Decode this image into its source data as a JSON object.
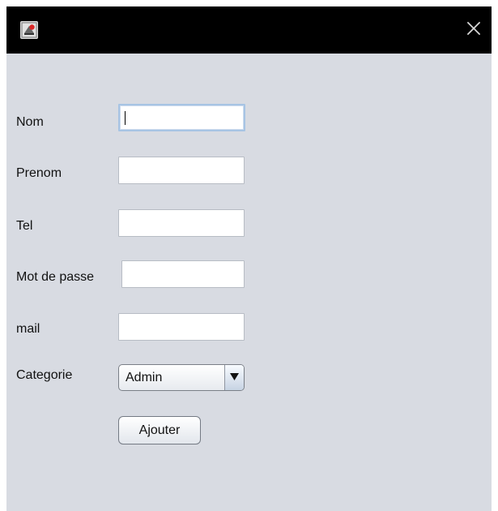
{
  "window": {
    "app_icon": "app-card-icon",
    "close_icon": "close-icon"
  },
  "form": {
    "fields": [
      {
        "label": "Nom",
        "value": ""
      },
      {
        "label": "Prenom",
        "value": ""
      },
      {
        "label": "Tel",
        "value": ""
      },
      {
        "label": "Mot de passe",
        "value": ""
      },
      {
        "label": "mail",
        "value": ""
      }
    ],
    "category": {
      "label": "Categorie",
      "selected": "Admin"
    },
    "submit_label": "Ajouter"
  }
}
